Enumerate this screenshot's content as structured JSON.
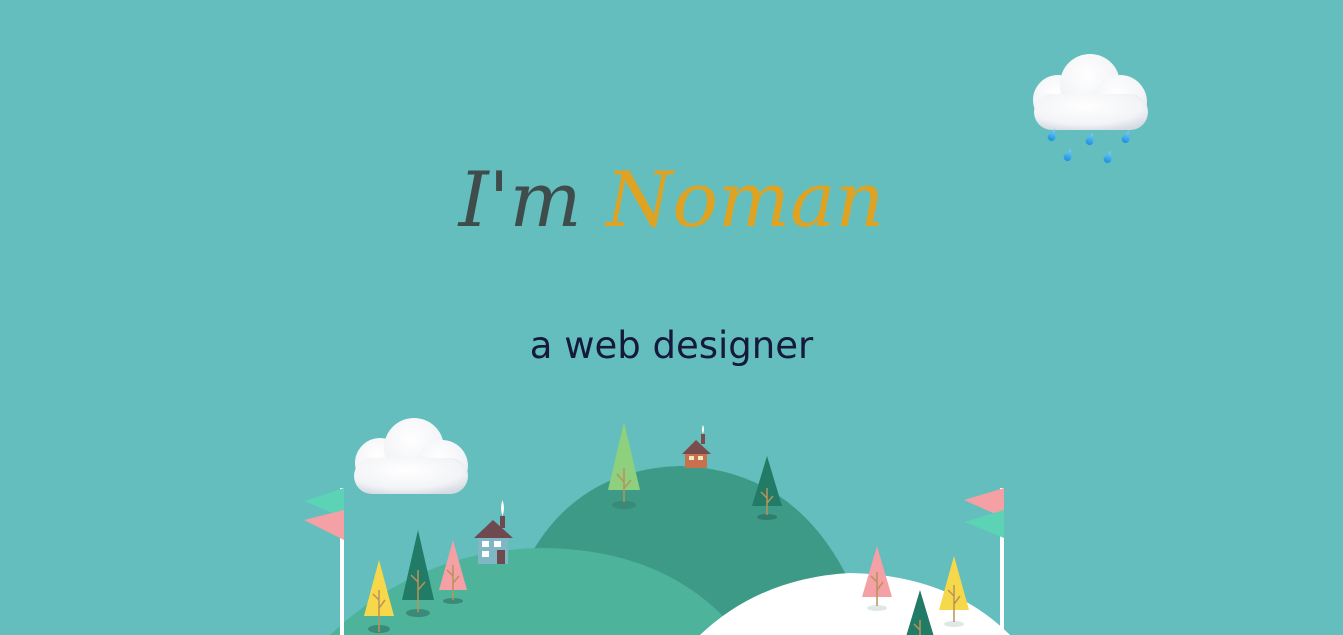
{
  "hero": {
    "greeting": "I'm",
    "name": "Noman",
    "tagline": "a web designer"
  },
  "icons": {
    "top_right": "rain-cloud-icon",
    "scene_left": "cloud-icon"
  },
  "colors": {
    "background": "#63bebd",
    "greeting_text": "#3f4c4c",
    "name_accent": "#dfa324",
    "tagline_text": "#151a3c",
    "hill_back": "#3d9a86",
    "hill_front": "#4db39a",
    "snow_hill": "#ffffff",
    "flag_pink": "#f4a0a4",
    "flag_mint": "#5bd3b4"
  }
}
